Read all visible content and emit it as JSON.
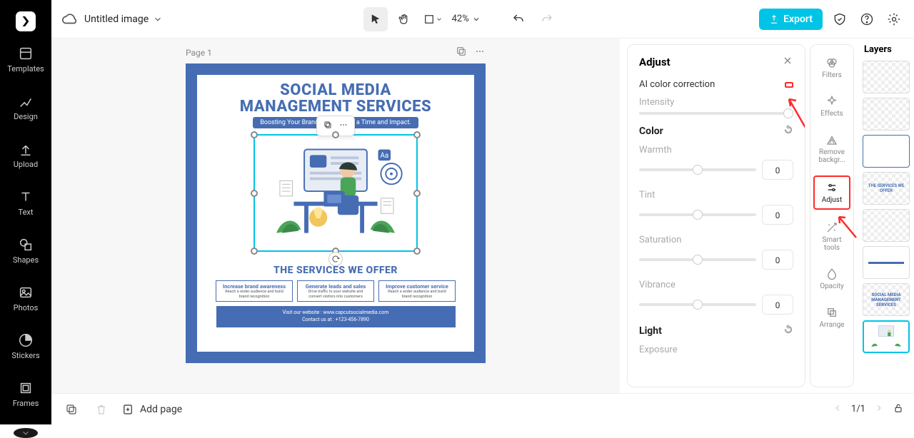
{
  "sidebar": {
    "items": [
      {
        "label": "Templates"
      },
      {
        "label": "Design"
      },
      {
        "label": "Upload"
      },
      {
        "label": "Text"
      },
      {
        "label": "Shapes"
      },
      {
        "label": "Photos"
      },
      {
        "label": "Stickers"
      },
      {
        "label": "Frames"
      }
    ]
  },
  "topbar": {
    "title": "Untitled image",
    "zoom": "42%",
    "export_label": "Export"
  },
  "page": {
    "label": "Page 1"
  },
  "design": {
    "heading_line1": "SOCIAL MEDIA",
    "heading_line2": "MANAGEMENT SERVICES",
    "subtitle": "Boosting Your Brand, One Post at a Time and Impact.",
    "services_title": "THE SERVICES WE OFFER",
    "svc": [
      {
        "h": "Increase brand awareness",
        "t": "Reach a wider audience and build brand recognition"
      },
      {
        "h": "Generate leads and sales",
        "t": "Drive traffic to your website and convert visitors into customers"
      },
      {
        "h": "Improve customer service",
        "t": "Reach a wider audience and build brand recognition"
      }
    ],
    "footer_line1": "Visit our website : www.capcutsocialmedia.com",
    "footer_line2": "Contact us at : +123-456-7890"
  },
  "adjust": {
    "title": "Adjust",
    "ai_label": "AI color correction",
    "intensity_label": "Intensity",
    "color_section": "Color",
    "warmth_label": "Warmth",
    "warmth_val": "0",
    "tint_label": "Tint",
    "tint_val": "0",
    "saturation_label": "Saturation",
    "saturation_val": "0",
    "vibrance_label": "Vibrance",
    "vibrance_val": "0",
    "light_section": "Light",
    "exposure_label": "Exposure"
  },
  "rail": {
    "items": [
      {
        "label": "Filters"
      },
      {
        "label": "Effects"
      },
      {
        "label": "Remove backgr..."
      },
      {
        "label": "Adjust"
      },
      {
        "label": "Smart tools"
      },
      {
        "label": "Opacity"
      },
      {
        "label": "Arrange"
      }
    ]
  },
  "layers": {
    "title": "Layers"
  },
  "bottombar": {
    "add_page": "Add page",
    "page_indicator": "1/1"
  }
}
